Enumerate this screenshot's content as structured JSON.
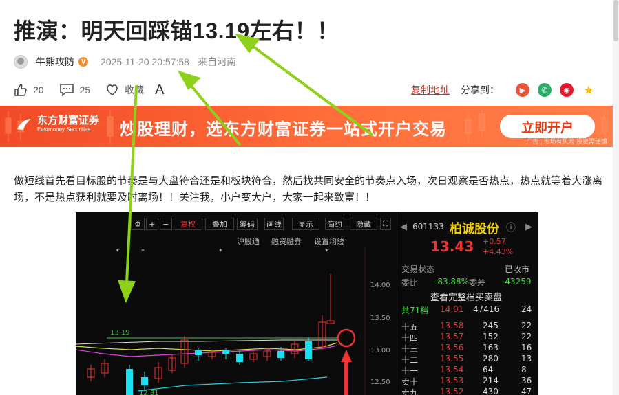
{
  "article": {
    "title": "推演：明天回踩锚13.19左右！！",
    "author": "牛熊攻防",
    "verified_badge": "V",
    "time": "2025-11-20 20:57:58",
    "location": "来自河南",
    "likes": "20",
    "comments": "25",
    "favorite_label": "收藏",
    "font_label": "A",
    "copy_link": "复制地址",
    "share_label": "分享到：",
    "body": "做短线首先看目标股的节奏是与大盘符合还是和板块符合，然后找共同安全的节奏点入场，次日观察是否热点，热点就等着大涨离场，不是热点获利就要及时离场！！关注我，小户变大户，大家一起来致富！！"
  },
  "banner": {
    "brand_cn": "东方财富证券",
    "brand_en": "Eastmoney Securities",
    "slogan": "炒股理财，选东方财富证券一站式开户交易",
    "button": "立即开户",
    "ad_note": "广告 | 市场有风险 投资需谨慎"
  },
  "stock_chart": {
    "toolbar": [
      "复权",
      "叠加",
      "筹码",
      "画线",
      "显示",
      "简约",
      "隐藏"
    ],
    "sub_toolbar": [
      "沪股通",
      "融资融券",
      "设置均线"
    ],
    "price_ticks": [
      "14.00",
      "13.50",
      "13.00",
      "12.50"
    ],
    "support_label": "13.19",
    "bottom_label": "12.31",
    "code": "601133",
    "name": "柏诚股份",
    "price": "13.43",
    "change": "+0.57",
    "change_pct": "+4.43%",
    "status_label": "交易状态",
    "status_value": "已收市",
    "weibi_label": "委比",
    "weibi_value": "-83.88%",
    "weicha_label": "委差",
    "weicha_value": "-43259",
    "full_book": "查看完整档买卖盘",
    "levels_label": "共71档",
    "levels_price": "14.01",
    "levels_vol": "47416",
    "levels_count": "24",
    "order_rows": [
      {
        "label": "十五",
        "price": "13.58",
        "vol": "245",
        "n": "22"
      },
      {
        "label": "十四",
        "price": "13.57",
        "vol": "152",
        "n": "22"
      },
      {
        "label": "十三",
        "price": "13.56",
        "vol": "163",
        "n": "16"
      },
      {
        "label": "十二",
        "price": "13.55",
        "vol": "280",
        "n": "13"
      },
      {
        "label": "十一",
        "price": "13.54",
        "vol": "64",
        "n": "8"
      },
      {
        "label": "卖十",
        "price": "13.53",
        "vol": "214",
        "n": "36"
      },
      {
        "label": "卖九",
        "price": "13.52",
        "vol": "430",
        "n": "47"
      }
    ]
  }
}
